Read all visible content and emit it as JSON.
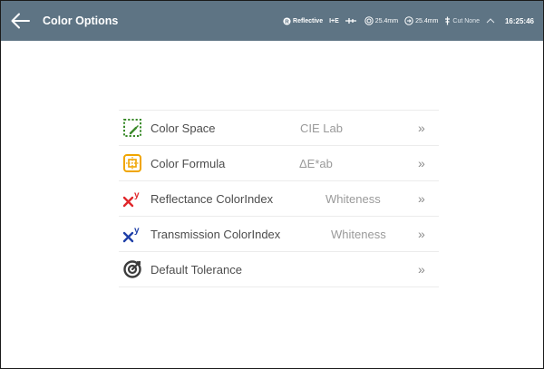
{
  "header": {
    "title": "Color Options",
    "back_icon": "arrow-left-icon"
  },
  "status": {
    "mode": "Reflective",
    "ie": "I+E",
    "aperture1": "25.4mm",
    "aperture2": "25.4mm",
    "cut": "Cut None",
    "time": "16:25:46"
  },
  "menu": {
    "items": [
      {
        "label": "Color Space",
        "value": "CIE Lab",
        "icon": "color-space-icon"
      },
      {
        "label": "Color Formula",
        "value": "ΔE*ab",
        "icon": "color-formula-icon"
      },
      {
        "label": "Reflectance ColorIndex",
        "value": "Whiteness",
        "icon": "reflectance-index-icon"
      },
      {
        "label": "Transmission ColorIndex",
        "value": "Whiteness",
        "icon": "transmission-index-icon"
      },
      {
        "label": "Default Tolerance",
        "value": "",
        "icon": "tolerance-target-icon"
      }
    ],
    "chevron": "»"
  },
  "colors": {
    "header_bg": "#5e7484",
    "icon_green": "#3a8a2a",
    "icon_orange": "#f0a500",
    "icon_red": "#e0262a",
    "icon_blue": "#1f3fa8"
  }
}
